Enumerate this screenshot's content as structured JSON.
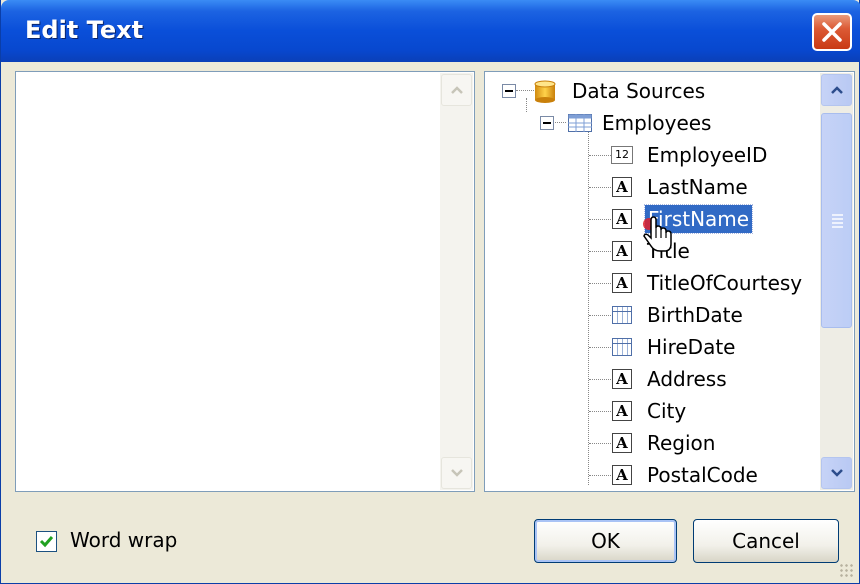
{
  "window": {
    "title": "Edit Text"
  },
  "editor": {
    "text": ""
  },
  "tree": {
    "root": {
      "label": "Data Sources",
      "icon": "database-icon"
    },
    "table": {
      "label": "Employees",
      "icon": "table-icon"
    },
    "fields": [
      {
        "label": "EmployeeID",
        "icon": "number-field-icon",
        "icon_text": "12"
      },
      {
        "label": "LastName",
        "icon": "text-field-icon",
        "icon_text": "A"
      },
      {
        "label": "FirstName",
        "icon": "text-field-icon",
        "icon_text": "A",
        "selected": true
      },
      {
        "label": "Title",
        "icon": "text-field-icon",
        "icon_text": "A"
      },
      {
        "label": "TitleOfCourtesy",
        "icon": "text-field-icon",
        "icon_text": "A"
      },
      {
        "label": "BirthDate",
        "icon": "date-field-icon"
      },
      {
        "label": "HireDate",
        "icon": "date-field-icon"
      },
      {
        "label": "Address",
        "icon": "text-field-icon",
        "icon_text": "A"
      },
      {
        "label": "City",
        "icon": "text-field-icon",
        "icon_text": "A"
      },
      {
        "label": "Region",
        "icon": "text-field-icon",
        "icon_text": "A"
      },
      {
        "label": "PostalCode",
        "icon": "text-field-icon",
        "icon_text": "A"
      }
    ]
  },
  "footer": {
    "word_wrap_label": "Word wrap",
    "word_wrap_checked": true,
    "ok_label": "OK",
    "cancel_label": "Cancel"
  }
}
